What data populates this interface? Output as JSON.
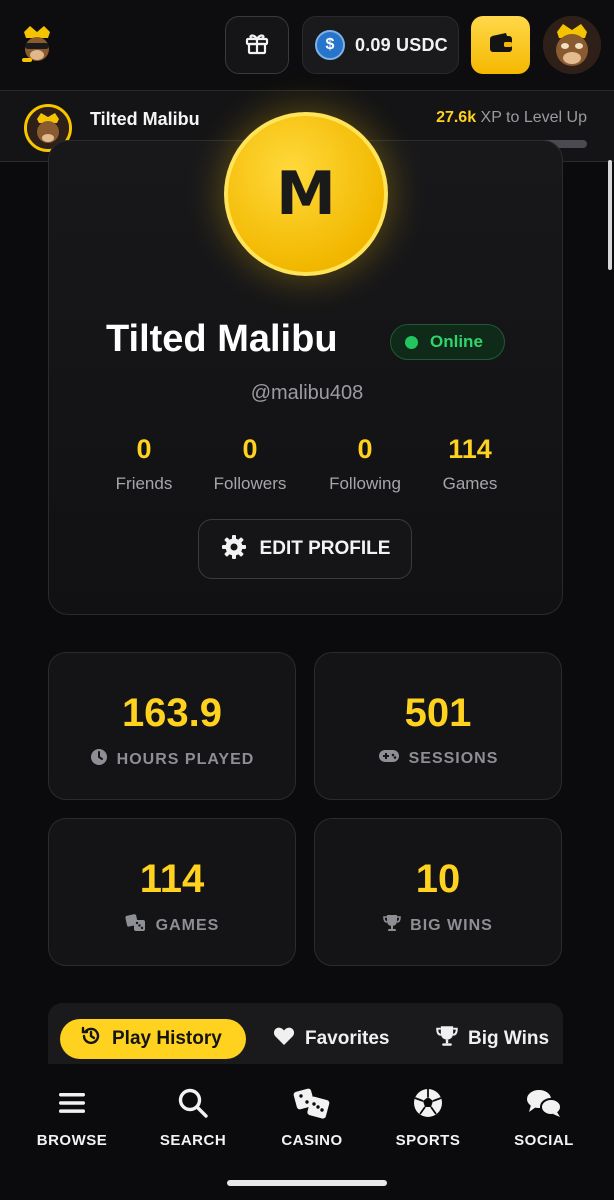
{
  "header": {
    "balance": "0.09 USDC",
    "balance_currency_icon": "usdc-coin-icon",
    "gift_icon": "gift-icon",
    "wallet_icon": "wallet-icon",
    "accent_color": "#ffd21f"
  },
  "level": {
    "name": "Tilted Malibu",
    "xp_amount": "27.6k",
    "xp_suffix": " XP to Level Up",
    "progress_fraction": 0.45
  },
  "profile": {
    "avatar_letter": "M",
    "name": "Tilted Malibu",
    "status": "Online",
    "status_color": "#22c55e",
    "handle": "@malibu408",
    "stats": [
      {
        "value": "0",
        "label": "Friends"
      },
      {
        "value": "0",
        "label": "Followers"
      },
      {
        "value": "0",
        "label": "Following"
      },
      {
        "value": "114",
        "label": "Games"
      }
    ],
    "edit_label": "EDIT PROFILE"
  },
  "tiles": [
    {
      "value": "163.9",
      "label": "HOURS PLAYED",
      "icon": "clock-icon"
    },
    {
      "value": "501",
      "label": "SESSIONS",
      "icon": "gamepad-icon"
    },
    {
      "value": "114",
      "label": "GAMES",
      "icon": "dice-icon"
    },
    {
      "value": "10",
      "label": "BIG WINS",
      "icon": "trophy-icon"
    }
  ],
  "tabs": [
    {
      "label": "Play History",
      "icon": "history-icon",
      "active": true
    },
    {
      "label": "Favorites",
      "icon": "heart-icon",
      "active": false
    },
    {
      "label": "Big Wins",
      "icon": "trophy-icon",
      "active": false
    }
  ],
  "nav": [
    {
      "label": "BROWSE",
      "icon": "menu-icon"
    },
    {
      "label": "SEARCH",
      "icon": "search-icon"
    },
    {
      "label": "CASINO",
      "icon": "dice-icon"
    },
    {
      "label": "SPORTS",
      "icon": "soccer-ball-icon"
    },
    {
      "label": "SOCIAL",
      "icon": "chat-bubbles-icon"
    }
  ]
}
